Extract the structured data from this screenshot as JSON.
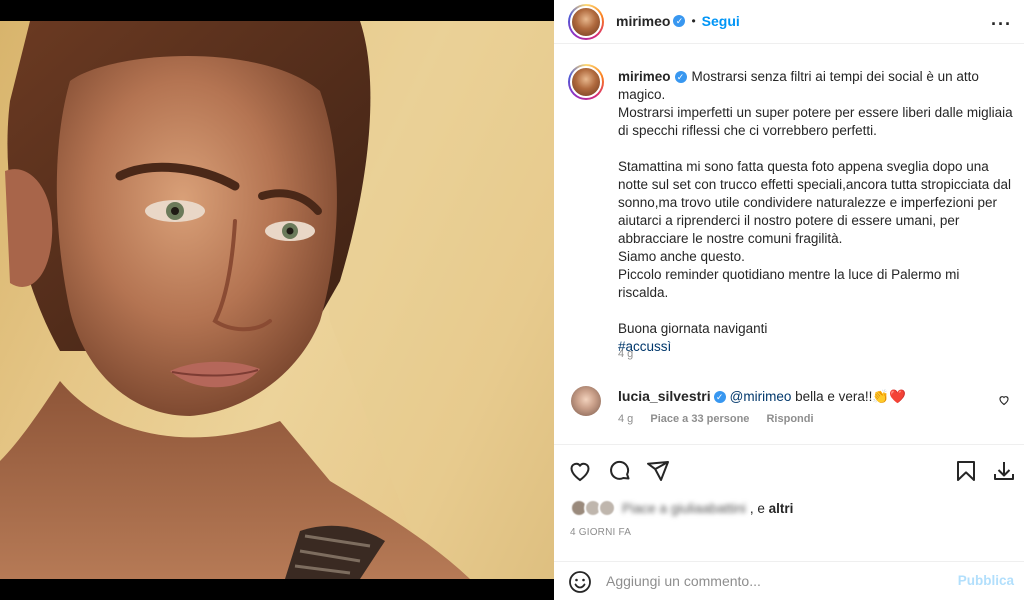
{
  "post": {
    "username": "mirimeo",
    "follow_label": "Segui",
    "more_icon": "more-horizontal-icon",
    "photo_alt_icon": "photo"
  },
  "caption": {
    "username": "mirimeo",
    "text": "Mostrarsi senza filtri ai tempi dei social è un atto magico.\nMostrarsi imperfetti un super potere per essere liberi dalle migliaia di specchi riflessi che ci vorrebbero perfetti.\n\nStamattina mi sono fatta questa foto appena sveglia dopo una notte sul set con trucco effetti speciali,ancora tutta stropicciata dal sonno,ma trovo utile condividere naturalezze e imperfezioni per aiutarci a riprenderci il nostro potere di essere umani, per abbracciare le nostre comuni fragilità.\nSiamo anche questo.\nPiccolo reminder quotidiano mentre la luce di Palermo mi riscalda.\n\nBuona giornata naviganti\n",
    "hashtag": "#accussì",
    "time": "4 g"
  },
  "comment": {
    "username": "lucia_silvestri",
    "mention": "@mirimeo",
    "text": " bella e vera!!👏❤️",
    "time": "4 g",
    "likes": "Piace a 33 persone",
    "reply": "Rispondi"
  },
  "likes": {
    "blurred_text": "Piace a giuliaabattini",
    "suffix": ", e",
    "others": "altri"
  },
  "days_ago": "4 GIORNI FA",
  "add_comment": {
    "placeholder": "Aggiungi un commento...",
    "publish": "Pubblica"
  },
  "colors": {
    "accent": "#0095f6",
    "verified": "#3897f0",
    "publish_disabled": "#b2dffc",
    "muted": "#8e8e8e",
    "hashtag": "#00376b"
  }
}
